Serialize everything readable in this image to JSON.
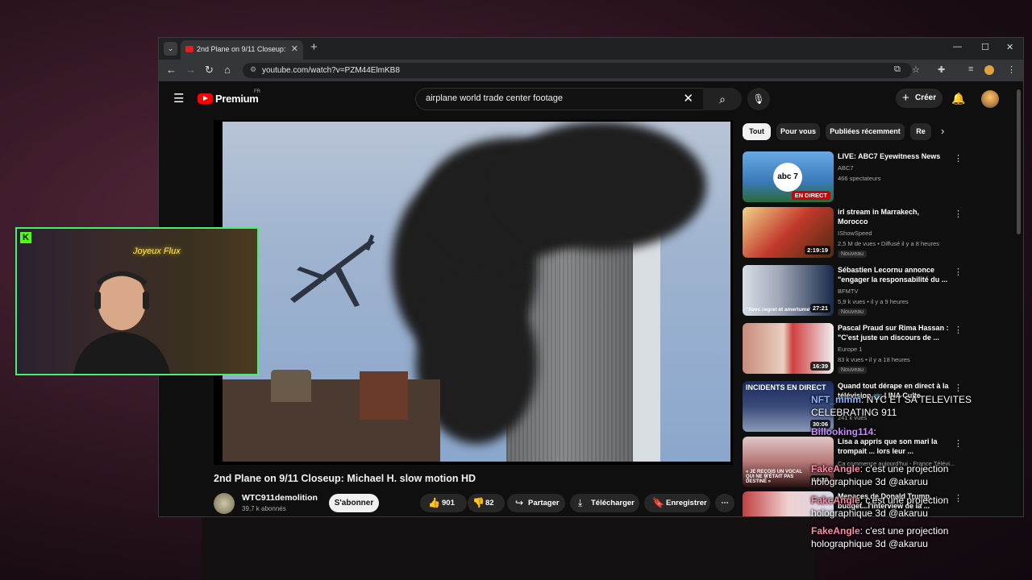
{
  "browser": {
    "tab_title": "2nd Plane on 9/11 Closeup: Mic",
    "url": "youtube.com/watch?v=PZM44ElmKB8"
  },
  "yt": {
    "logo": "Premium",
    "region": "FR",
    "search_query": "airplane world trade center footage",
    "create_label": "Créer"
  },
  "video": {
    "title": "2nd Plane on 9/11 Closeup: Michael H. slow motion HD",
    "channel": "WTC911demolition",
    "subscribers": "39,7 k abonnés",
    "subscribe_label": "S'abonner",
    "likes": "901",
    "dislikes": "82",
    "share_label": "Partager",
    "download_label": "Télécharger",
    "save_label": "Enregistrer"
  },
  "chips": [
    "Tout",
    "Pour vous",
    "Publiées récemment",
    "Re"
  ],
  "recommendations": [
    {
      "title": "LIVE: ABC7 Eyewitness News",
      "channel": "ABC7",
      "meta": "466 spectateurs",
      "badge": "EN DIRECT",
      "thumb_text": "abc 7",
      "new": ""
    },
    {
      "title": "irl stream in Marrakech, Morocco",
      "channel": "IShowSpeed",
      "meta": "2,5 M de vues • Diffusé il y a 8 heures",
      "badge": "2:19:19",
      "thumb_text": "",
      "new": "Nouveau"
    },
    {
      "title": "Sébastien Lecornu annonce \"engager la responsabilité du ...",
      "channel": "BFMTV",
      "meta": "5,9 k vues • il y a 9 heures",
      "badge": "27:21",
      "thumb_text": "\"Avec regret et amertume\"",
      "new": "Nouveau"
    },
    {
      "title": "Pascal Praud sur Rima Hassan : \"C'est juste un discours de ...",
      "channel": "Europe 1",
      "meta": "83 k vues • il y a 18 heures",
      "badge": "16:39",
      "thumb_text": "",
      "new": "Nouveau"
    },
    {
      "title": "Quand tout dérape en direct à la télévision 📺 | INA Culte",
      "channel": "",
      "meta": "241 k vues",
      "badge": "30:06",
      "thumb_text": "INCIDENTS EN DIRECT",
      "new": ""
    },
    {
      "title": "Lisa a appris que son mari la trompait ... lors leur ...",
      "channel": "Ça commence aujourd'hui - France Télévi...",
      "meta": "",
      "badge": "14:30",
      "thumb_text": "« JE REÇOIS UN VOCAL QUI NE M'ÉTAIT PAS DESTINÉ »",
      "new": ""
    },
    {
      "title": "Menaces de Donald Trump, budget...l'interview de la ...",
      "channel": "",
      "meta": "",
      "badge": "",
      "thumb_text": "",
      "new": ""
    }
  ],
  "stream_overlay": {
    "logo": "K",
    "neon_sign": "Joyeux Flux",
    "chat": [
      {
        "user": "NFT_mmm",
        "text": ": NYC ET SA TELEVITES"
      },
      {
        "user": "",
        "text": "CELEBRATING 911"
      },
      {
        "user": "Billooking114",
        "text": ":"
      },
      {
        "user": "FakeAngle",
        "text": ": c'est une projection"
      },
      {
        "user": "",
        "text": "holographique 3d @akaruu"
      },
      {
        "user": "FakeAngle",
        "text": ": c'est une projection"
      },
      {
        "user": "",
        "text": "holographique 3d @akaruu"
      },
      {
        "user": "FakeAngle",
        "text": ": c'est une projection"
      },
      {
        "user": "",
        "text": "holographique 3d @akaruu"
      }
    ]
  },
  "colors": {
    "yt_bg": "#0f0f0f",
    "yt_red": "#ff0000",
    "kick_green": "#53fc18",
    "chip_bg": "#272727"
  }
}
